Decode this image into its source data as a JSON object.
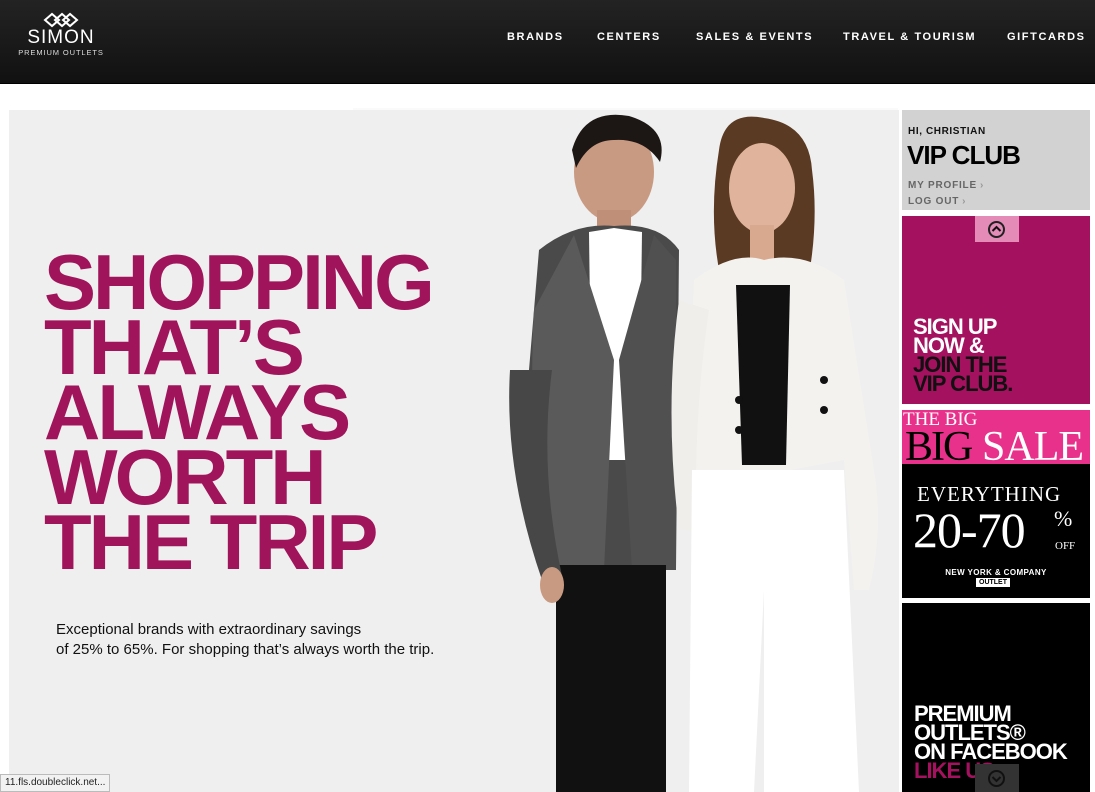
{
  "header": {
    "logo": {
      "brand": "SIMON",
      "sub": "PREMIUM OUTLETS",
      "icon": "simon-diamond-logo-icon"
    },
    "nav": [
      "BRANDS",
      "CENTERS",
      "SALES & EVENTS",
      "TRAVEL & TOURISM",
      "GIFTCARDS"
    ]
  },
  "hero": {
    "headline": [
      "SHOPPING",
      "THAT’S",
      "ALWAYS",
      "WORTH",
      "THE TRIP"
    ],
    "tagline_1": "Exceptional brands with extraordinary savings",
    "tagline_2": "of 25% to 65%. For shopping that’s always worth the trip.",
    "colors": {
      "headline": "#a0145c",
      "background": "#efefef"
    }
  },
  "vip": {
    "greeting": "HI, CHRISTIAN",
    "title": "VIP CLUB",
    "my_profile": "MY PROFILE",
    "log_out": "LOG OUT"
  },
  "signup": {
    "line1": "SIGN UP",
    "line2": "NOW &",
    "line3": "JOIN THE",
    "line4": "VIP CLUB.",
    "up_icon": "chevron-up-circle-icon",
    "color": "#a4115e"
  },
  "sale": {
    "the_big": "THE BIG",
    "big": "BIG",
    "sale": "SALE",
    "everything": "EVERYTHING",
    "range": "20-70",
    "percent": "%",
    "off": "OFF",
    "brand": "NEW YORK & COMPANY",
    "outlet": "OUTLET",
    "color": "#e8318a"
  },
  "facebook": {
    "line1": "PREMIUM",
    "line2": "OUTLETS®",
    "line3": "ON FACEBOOK",
    "line4": "LIKE US",
    "down_icon": "chevron-down-circle-icon"
  },
  "status_bar": "11.fls.doubleclick.net..."
}
